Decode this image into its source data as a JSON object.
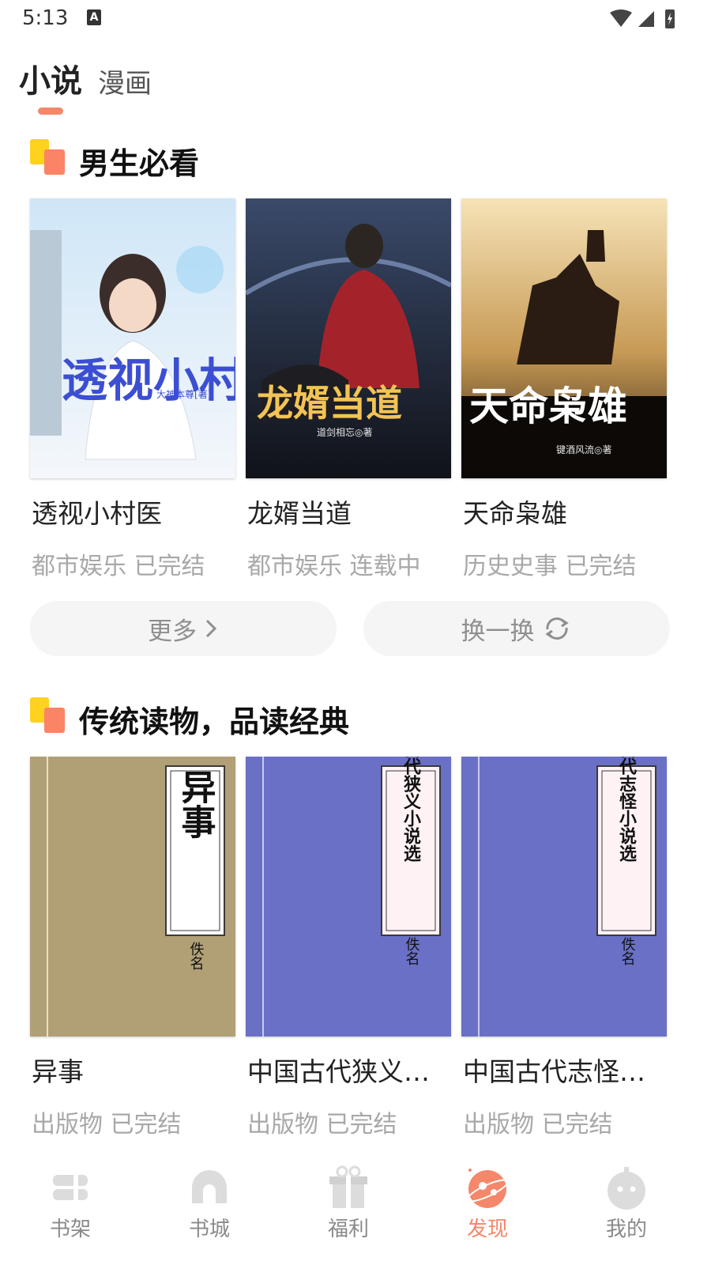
{
  "status": {
    "time": "5:13",
    "a_glyph": "A"
  },
  "tabs": [
    {
      "label": "小说"
    },
    {
      "label": "漫画"
    }
  ],
  "section1": {
    "title": "男生必看",
    "books": [
      {
        "title": "透视小村医",
        "category": "都市娱乐",
        "status": "已完结",
        "cover_title": "透视小村医",
        "cover_author": "大神本尊[著]"
      },
      {
        "title": "龙婿当道",
        "category": "都市娱乐",
        "status": "连载中",
        "cover_title": "龙婿当道",
        "cover_author": "道剑相忘◎著"
      },
      {
        "title": "天命枭雄",
        "category": "历史史事",
        "status": "已完结",
        "cover_title": "天命枭雄",
        "cover_author": "键酒风流◎著"
      }
    ],
    "more_label": "更多",
    "refresh_label": "换一换"
  },
  "section2": {
    "title": "传统读物，品读经典",
    "books": [
      {
        "title": "异事",
        "category": "出版物",
        "status": "已完结",
        "cover_title": "异事",
        "cover_author": "佚名"
      },
      {
        "title": "中国古代狭义…",
        "category": "出版物",
        "status": "已完结",
        "cover_title": "中国古代狭义小说选",
        "cover_author": "佚名"
      },
      {
        "title": "中国古代志怪…",
        "category": "出版物",
        "status": "已完结",
        "cover_title": "中国古代志怪小说选",
        "cover_author": "佚名"
      }
    ]
  },
  "nav": [
    {
      "label": "书架",
      "icon": "bookshelf-icon"
    },
    {
      "label": "书城",
      "icon": "bookstore-icon"
    },
    {
      "label": "福利",
      "icon": "gift-icon"
    },
    {
      "label": "发现",
      "icon": "discover-icon",
      "active": true
    },
    {
      "label": "我的",
      "icon": "profile-icon"
    }
  ],
  "colors": {
    "accent": "#f5876a",
    "yellow": "#ffd21e",
    "pill_bg": "#f5f5f5"
  }
}
